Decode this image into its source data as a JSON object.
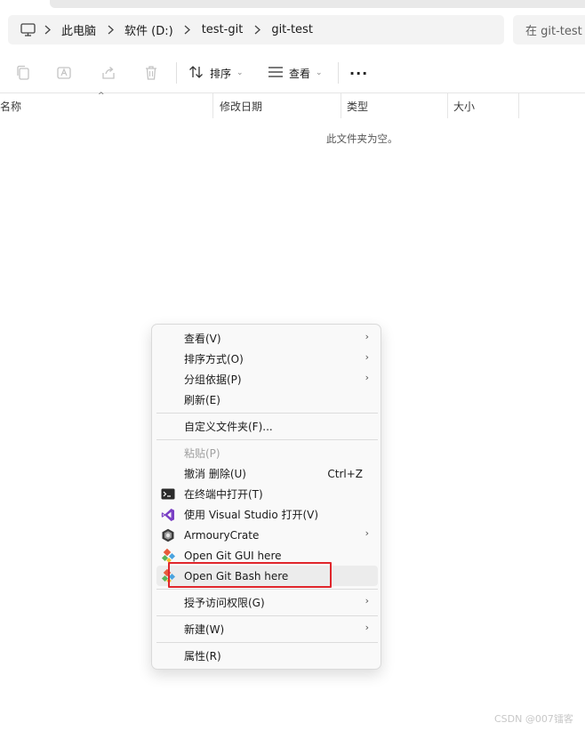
{
  "breadcrumbs": [
    "此电脑",
    "软件 (D:)",
    "test-git",
    "git-test"
  ],
  "search": {
    "placeholder": "在 git-test"
  },
  "toolbar": {
    "sort_label": "排序",
    "view_label": "查看",
    "more_label": "···"
  },
  "columns": [
    "名称",
    "修改日期",
    "类型",
    "大小"
  ],
  "empty_message": "此文件夹为空。",
  "context_menu": {
    "items": [
      {
        "label": "查看(V)",
        "submenu": true
      },
      {
        "label": "排序方式(O)",
        "submenu": true
      },
      {
        "label": "分组依据(P)",
        "submenu": true
      },
      {
        "label": "刷新(E)"
      },
      {
        "label": "自定义文件夹(F)..."
      },
      {
        "label": "粘贴(P)",
        "disabled": true
      },
      {
        "label": "撤消 删除(U)",
        "accelerator": "Ctrl+Z"
      },
      {
        "label": "在终端中打开(T)",
        "icon": "terminal-icon"
      },
      {
        "label": "使用 Visual Studio 打开(V)",
        "icon": "visual-studio-icon"
      },
      {
        "label": "ArmouryCrate",
        "icon": "armoury-crate-icon",
        "submenu": true
      },
      {
        "label": "Open Git GUI here",
        "icon": "git-icon"
      },
      {
        "label": "Open Git Bash here",
        "icon": "git-icon",
        "highlighted": true
      },
      {
        "label": "授予访问权限(G)",
        "submenu": true
      },
      {
        "label": "新建(W)",
        "submenu": true
      },
      {
        "label": "属性(R)"
      }
    ]
  },
  "watermark": "CSDN @007镭客",
  "colors": {
    "highlight_box": "#e0262c",
    "menu_bg": "#f9f9f9"
  }
}
